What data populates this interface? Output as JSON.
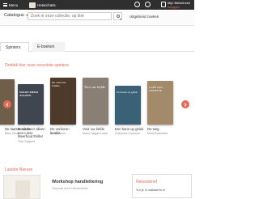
{
  "topbar": {
    "menu_label": "Menu",
    "brand": "Hetarchatis",
    "library_title": "Mijn Bibliotheek",
    "library_sub": "inloggen"
  },
  "search": {
    "catalog_label": "Catalogus",
    "placeholder": "Zoek in onze collectie, op titel",
    "advanced_label": "Uitgebreid zoeken"
  },
  "tabs": [
    {
      "label": "Spinters"
    },
    {
      "label": "E-boeken"
    }
  ],
  "carousel": {
    "title": "Ontdek hier onze recentste spinters",
    "books": [
      {
        "title": "De laatste mode",
        "author": "Ellen Orval",
        "cover_title": "",
        "color": "#6e5e4a"
      },
      {
        "title": "Nooit meer alleen een Liese Meerhout thriller",
        "author": "Toni Coppers",
        "cover_title": "NOOIT MEER ALLEEN",
        "color": "#3f4650"
      },
      {
        "title": "De verboren familie",
        "author": "Jamie Buon",
        "cover_title": "De verboren familie",
        "color": "#4d3a2a"
      },
      {
        "title": "Voor uw liefde",
        "author": "Mario Vargas Llosa",
        "cover_title": "Voor uw liefde",
        "color": "#8a7f75"
      },
      {
        "title": "Een kans op geluk",
        "author": "Catherine Cookson",
        "cover_title": "Een kans op geluk",
        "color": "#3a6175"
      },
      {
        "title": "De weg",
        "author": "Mina Rosenthal",
        "cover_title": "CAFÉ VAN ANNETTE",
        "color": "#a28a6a"
      }
    ]
  },
  "news": {
    "title": "Laatste Nieuws",
    "item_title": "Workshop handlettering",
    "item_meta": "Geplaat door Hetarchatis",
    "newsletter_title": "Nieuwsbrief",
    "newsletter_text": "Vul je e-mailadres in"
  },
  "colors": {
    "accent": "#e46a5a",
    "topbar": "#2f2f2f"
  }
}
